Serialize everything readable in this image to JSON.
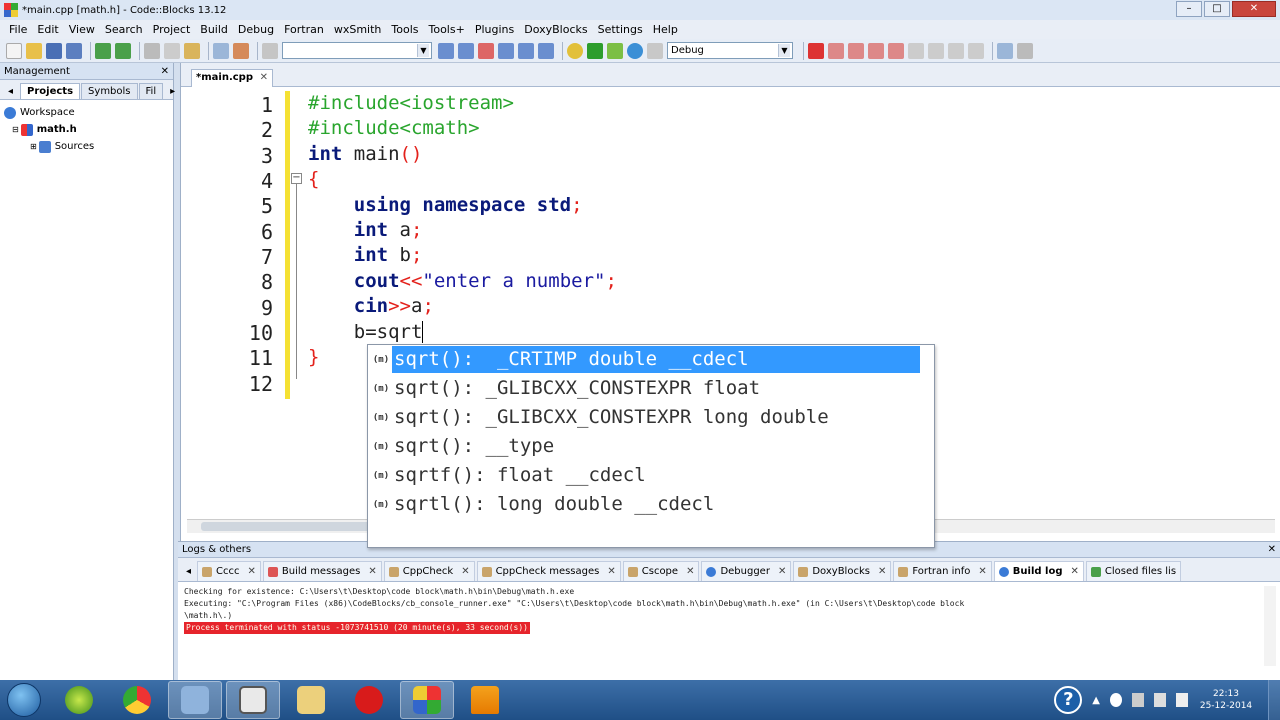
{
  "window": {
    "title": "*main.cpp [math.h] - Code::Blocks 13.12"
  },
  "menu": [
    "File",
    "Edit",
    "View",
    "Search",
    "Project",
    "Build",
    "Debug",
    "Fortran",
    "wxSmith",
    "Tools",
    "Tools+",
    "Plugins",
    "DoxyBlocks",
    "Settings",
    "Help"
  ],
  "toolbar": {
    "search_value": "",
    "build_target": "Debug"
  },
  "management": {
    "title": "Management",
    "tabs": [
      "Projects",
      "Symbols",
      "Fil"
    ],
    "tree": {
      "workspace": "Workspace",
      "project": "math.h",
      "folder": "Sources"
    }
  },
  "editor": {
    "tab_label": "*main.cpp",
    "line_numbers": [
      "1",
      "2",
      "3",
      "4",
      "5",
      "6",
      "7",
      "8",
      "9",
      "10",
      "11",
      "12"
    ]
  },
  "code": {
    "l1": "#include<iostream>",
    "l2": "#include<cmath>",
    "l3_kw": "int",
    "l3_rest": " main",
    "l3_op": "()",
    "l4": "{",
    "l5_kw": "using namespace std",
    "l5_op": ";",
    "l6_kw": "int",
    "l6_rest": " a",
    "l6_op": ";",
    "l7_kw": "int",
    "l7_rest": " b",
    "l7_op": ";",
    "l8_kw": "cout",
    "l8_op": "<<",
    "l8_str": "\"enter a number\"",
    "l8_op2": ";",
    "l9_kw": "cin",
    "l9_op": ">>",
    "l9_rest": "a",
    "l9_op2": ";",
    "l10_rest": "b=sqrt",
    "l11": "}"
  },
  "autocomplete": [
    {
      "icon": "(m)",
      "text": "sqrt():  _CRTIMP double __cdecl"
    },
    {
      "icon": "(m)",
      "text": "sqrt(): _GLIBCXX_CONSTEXPR float"
    },
    {
      "icon": "(m)",
      "text": "sqrt(): _GLIBCXX_CONSTEXPR long double"
    },
    {
      "icon": "(m)",
      "text": "sqrt(): __type"
    },
    {
      "icon": "(m)",
      "text": "sqrtf(): float __cdecl"
    },
    {
      "icon": "(m)",
      "text": "sqrtl(): long double __cdecl"
    }
  ],
  "logs": {
    "title": "Logs & others",
    "tabs": [
      "Cccc",
      "Build messages",
      "CppCheck",
      "CppCheck messages",
      "Cscope",
      "Debugger",
      "DoxyBlocks",
      "Fortran info",
      "Build log",
      "Closed files lis"
    ],
    "line1": "Checking for existence: C:\\Users\\t\\Desktop\\code block\\math.h\\bin\\Debug\\math.h.exe",
    "line2": "Executing: \"C:\\Program Files (x86)\\CodeBlocks/cb_console_runner.exe\" \"C:\\Users\\t\\Desktop\\code block\\math.h\\bin\\Debug\\math.h.exe\"  (in C:\\Users\\t\\Desktop\\code block",
    "line3": "\\math.h\\.)",
    "error": "Process terminated with status -1073741510 (20 minute(s), 33 second(s))"
  },
  "taskbar": {
    "time": "22:13",
    "date": "25-12-2014"
  }
}
